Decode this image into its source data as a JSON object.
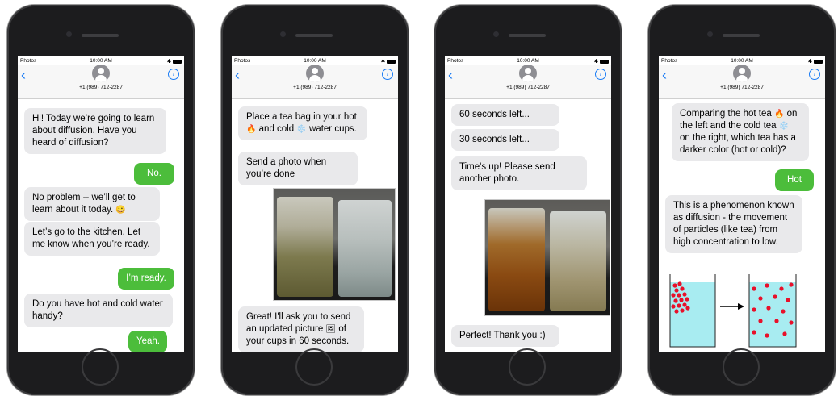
{
  "status": {
    "carrier": "Photos",
    "time": "10:00 AM"
  },
  "contact": {
    "phone": "+1 (989) 712-2287"
  },
  "icons": {
    "back": "chevron-left-icon",
    "info": "info-icon"
  },
  "screens": [
    {
      "messages": [
        {
          "from": "bot",
          "text": "Hi! Today we’re going to learn about diffusion. Have you heard of diffusion?"
        },
        {
          "from": "user",
          "text": "No."
        },
        {
          "from": "bot",
          "text": "No problem -- we’ll get to learn about it today."
        },
        {
          "from": "bot",
          "text": "Let’s go to the kitchen. Let me know when you’re ready."
        },
        {
          "from": "user",
          "text": "I’m ready."
        },
        {
          "from": "bot",
          "text": "Do you have hot and cold water handy?"
        },
        {
          "from": "user",
          "text": "Yeah."
        }
      ]
    },
    {
      "messages": [
        {
          "from": "bot",
          "text_a": "Place a tea bag in your hot",
          "text_b": "and cold",
          "text_c": "water cups."
        },
        {
          "from": "bot",
          "text": "Send a photo when you’re done"
        },
        {
          "from": "bot",
          "text_a": "Great! I'll ask you to send an updated picture",
          "text_b": "of your cups in 60 seconds."
        }
      ]
    },
    {
      "messages": [
        {
          "from": "bot",
          "text": "60 seconds left..."
        },
        {
          "from": "bot",
          "text": "30 seconds left..."
        },
        {
          "from": "bot",
          "text": "Time's up! Please send another photo."
        },
        {
          "from": "bot",
          "text": "Perfect! Thank you :)"
        }
      ]
    },
    {
      "messages": [
        {
          "from": "bot",
          "text_a": "Comparing the hot tea",
          "text_b": "on the left and the cold tea",
          "text_c": "on the right, which tea has a darker color (hot or cold)?"
        },
        {
          "from": "user",
          "text": "Hot"
        },
        {
          "from": "bot",
          "text": "This is a phenomenon known as diffusion - the movement of particles (like tea) from high concentration to low."
        }
      ]
    }
  ],
  "colors": {
    "bubble_out": "#4cbd3b",
    "bubble_in": "#e9e9eb",
    "accent": "#1a7cf5"
  }
}
